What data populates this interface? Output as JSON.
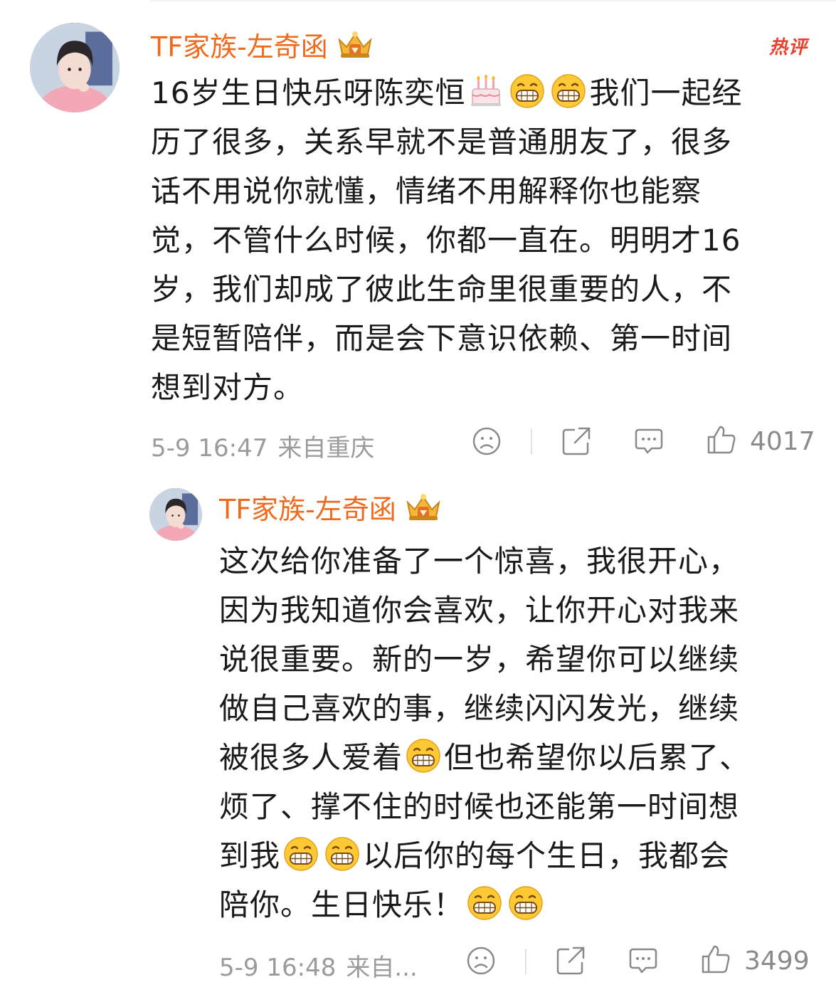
{
  "comments": [
    {
      "author": "TF家族-左奇函",
      "badge": "热评",
      "body_lines": [
        [
          "16岁生日快乐呀陈奕恒",
          {
            "emoji": "birthday-cake"
          },
          {
            "emoji": "grin"
          },
          {
            "emoji": "grin"
          },
          "我们一起经"
        ],
        [
          "历了很多，关系早就不是普通朋友了，很多"
        ],
        [
          "话不用说你就懂，情绪不用解释你也能察"
        ],
        [
          "觉，不管什么时候，你都一直在。明明才16"
        ],
        [
          "岁，我们却成了彼此生命里很重要的人，不"
        ],
        [
          "是短暂陪伴，而是会下意识依赖、第一时间"
        ],
        [
          "想到对方。"
        ]
      ],
      "time": "5-9 16:47",
      "location": "来自重庆",
      "likes": "4017"
    },
    {
      "author": "TF家族-左奇函",
      "body_lines": [
        [
          "这次给你准备了一个惊喜，我很开心，"
        ],
        [
          "因为我知道你会喜欢，让你开心对我来"
        ],
        [
          "说很重要。新的一岁，希望你可以继续"
        ],
        [
          "做自己喜欢的事，继续闪闪发光，继续"
        ],
        [
          "被很多人爱着",
          {
            "emoji": "grin"
          },
          "但也希望你以后累了、"
        ],
        [
          "烦了、撑不住的时候也还能第一时间想"
        ],
        [
          "到我",
          {
            "emoji": "grin"
          },
          {
            "emoji": "grin"
          },
          "以后你的每个生日，我都会"
        ],
        [
          "陪你。生日快乐！",
          {
            "emoji": "grin"
          },
          {
            "emoji": "grin"
          }
        ]
      ],
      "time": "5-9 16:48",
      "location": "来自...",
      "likes": "3499"
    }
  ],
  "icons": {
    "dislike": "sad-face-icon",
    "share": "share-icon",
    "comment": "comment-icon",
    "like": "thumbs-up-icon"
  },
  "colors": {
    "name": "#ef6a1c",
    "hot": "#e8412d",
    "meta": "#9b9b9b",
    "emoji_yellow": "#ffc935"
  }
}
